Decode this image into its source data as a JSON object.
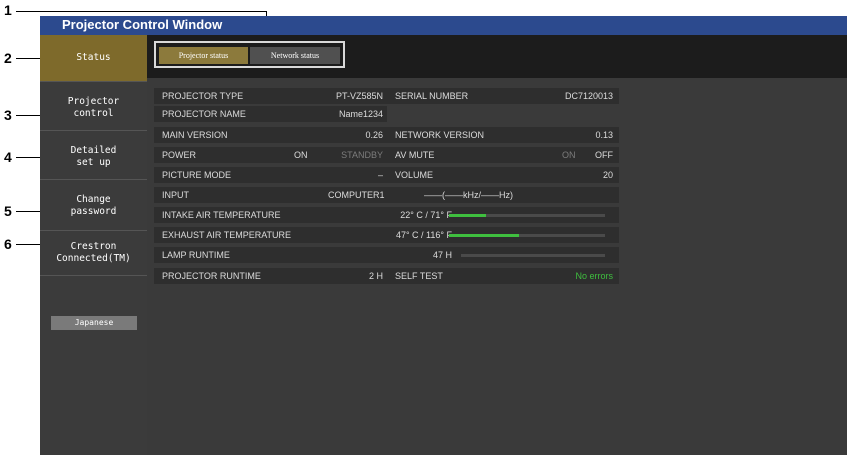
{
  "window": {
    "title": "Projector Control Window"
  },
  "callouts": [
    "1",
    "2",
    "3",
    "4",
    "5",
    "6"
  ],
  "sidebar": {
    "items": [
      {
        "label": "Status"
      },
      {
        "label": "Projector\ncontrol"
      },
      {
        "label": "Detailed\nset up"
      },
      {
        "label": "Change\npassword"
      },
      {
        "label": "Crestron\nConnected(TM)"
      }
    ],
    "language_button": "Japanese"
  },
  "tabs": [
    {
      "label": "Projector status",
      "active": true
    },
    {
      "label": "Network status",
      "active": false
    }
  ],
  "status": {
    "projector_type_label": "PROJECTOR TYPE",
    "projector_type": "PT-VZ585N",
    "serial_number_label": "SERIAL NUMBER",
    "serial_number": "DC7120013",
    "projector_name_label": "PROJECTOR NAME",
    "projector_name": "Name1234",
    "main_version_label": "MAIN VERSION",
    "main_version": "0.26",
    "network_version_label": "NETWORK VERSION",
    "network_version": "0.13",
    "power_label": "POWER",
    "power_on": "ON",
    "power_standby": "STANDBY",
    "av_mute_label": "AV MUTE",
    "av_mute_on": "ON",
    "av_mute_off": "OFF",
    "picture_mode_label": "PICTURE MODE",
    "picture_mode": "–",
    "volume_label": "VOLUME",
    "volume": "20",
    "input_label": "INPUT",
    "input": "COMPUTER1",
    "input_freq": "——(——kHz/——Hz)",
    "intake_label": "INTAKE AIR TEMPERATURE",
    "intake_value": "22° C / 71° F",
    "intake_level": 0.24,
    "exhaust_label": "EXHAUST AIR TEMPERATURE",
    "exhaust_value": "47° C / 116° F",
    "exhaust_level": 0.45,
    "lamp_runtime_label": "LAMP RUNTIME",
    "lamp_runtime": "47 H",
    "lamp_level": 0.0,
    "projector_runtime_label": "PROJECTOR RUNTIME",
    "projector_runtime": "2 H",
    "self_test_label": "SELF TEST",
    "self_test": "No errors"
  },
  "colors": {
    "title_bar": "#2c4a8e",
    "active": "#7e6a2b",
    "bar_fill": "#3fbf3f",
    "ok_text": "#3fbf3f"
  }
}
